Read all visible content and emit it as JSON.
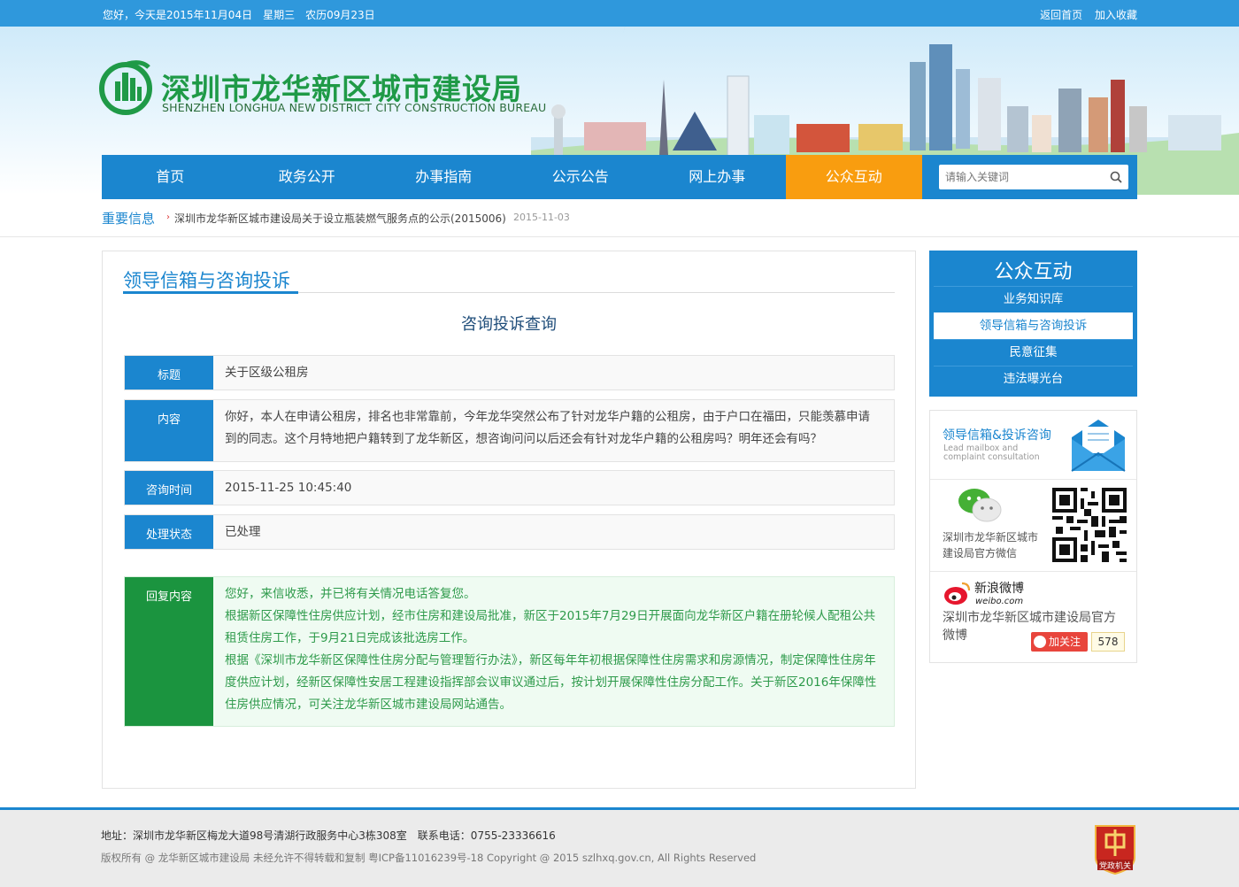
{
  "topbar": {
    "greeting": "您好，今天是2015年11月04日　星期三　农历09月23日",
    "home_link": "返回首页",
    "favorite_link": "加入收藏"
  },
  "header": {
    "title": "深圳市龙华新区城市建设局",
    "subtitle": "SHENZHEN  LONGHUA  NEW  DISTRICT  CITY CONSTRUCTION BUREAU"
  },
  "nav": {
    "items": [
      "首页",
      "政务公开",
      "办事指南",
      "公示公告",
      "网上办事",
      "公众互动"
    ],
    "active_index": 5,
    "search_placeholder": "请输入关键词"
  },
  "news": {
    "label": "重要信息",
    "headline": "深圳市龙华新区城市建设局关于设立瓶装燃气服务点的公示(2015006)",
    "date": "2015-11-03"
  },
  "main": {
    "section_title": "领导信箱与咨询投诉",
    "form_title": "咨询投诉查询",
    "rows": {
      "title": {
        "label": "标题",
        "value": "关于区级公租房"
      },
      "content": {
        "label": "内容",
        "value": "你好，本人在申请公租房，排名也非常靠前，今年龙华突然公布了针对龙华户籍的公租房，由于户口在福田，只能羡慕申请到的同志。这个月特地把户籍转到了龙华新区，想咨询问问以后还会有针对龙华户籍的公租房吗？明年还会有吗？"
      },
      "time": {
        "label": "咨询时间",
        "value": "2015-11-25 10:45:40"
      },
      "status": {
        "label": "处理状态",
        "value": "已处理"
      },
      "reply": {
        "label": "回复内容",
        "p1": "您好，来信收悉，并已将有关情况电话答复您。",
        "p2": "根据新区保障性住房供应计划，经市住房和建设局批准，新区于2015年7月29日开展面向龙华新区户籍在册轮候人配租公共租赁住房工作，于9月21日完成该批选房工作。",
        "p3": "根据《深圳市龙华新区保障性住房分配与管理暂行办法》，新区每年年初根据保障性住房需求和房源情况，制定保障性住房年度供应计划，经新区保障性安居工程建设指挥部会议审议通过后，按计划开展保障性住房分配工作。关于新区2016年保障性住房供应情况，可关注龙华新区城市建设局网站通告。"
      }
    }
  },
  "sidebar": {
    "menu_title": "公众互动",
    "menu_items": [
      "业务知识库",
      "领导信箱与咨询投诉",
      "民意征集",
      "违法曝光台"
    ],
    "active_index": 1,
    "mailbox_title": "领导信箱&投诉咨询",
    "mailbox_sub1": "Lead mailbox and",
    "mailbox_sub2": "complaint consultation",
    "wechat_text": "深圳市龙华新区城市建设局官方微信",
    "weibo_logo_cn": "新浪微博",
    "weibo_logo_en": "weibo.com",
    "weibo_text": "深圳市龙华新区城市建设局官方微博",
    "follow_label": "加关注",
    "follow_count": "578"
  },
  "footer": {
    "address": "地址：深圳市龙华新区梅龙大道98号清湖行政服务中心3栋308室　联系电话：0755-23336616",
    "copyright": "版权所有 @ 龙华新区城市建设局  未经允许不得转载和复制  粤ICP备11016239号-18    Copyright @ 2015 szlhxq.gov.cn, All Rights Reserved",
    "badge_text": "党政机关"
  },
  "colors": {
    "primary_blue": "#1b86cf",
    "active_orange": "#f99d0f",
    "reply_green": "#1b943f",
    "logo_green": "#1f9a47"
  }
}
